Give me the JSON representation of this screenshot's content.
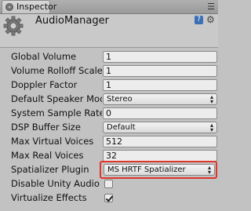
{
  "tab": {
    "label": "Inspector"
  },
  "header": {
    "title": "AudioManager"
  },
  "rows": [
    {
      "label": "Global Volume",
      "value": "1"
    },
    {
      "label": "Volume Rolloff Scale",
      "value": "1"
    },
    {
      "label": "Doppler Factor",
      "value": "1"
    },
    {
      "label": "Default Speaker Mode",
      "value": "Stereo"
    },
    {
      "label": "System Sample Rate",
      "value": "0"
    },
    {
      "label": "DSP Buffer Size",
      "value": "Default"
    },
    {
      "label": "Max Virtual Voices",
      "value": "512"
    },
    {
      "label": "Max Real Voices",
      "value": "32"
    },
    {
      "label": "Spatializer Plugin",
      "value": "MS HRTF Spatializer"
    },
    {
      "label": "Disable Unity Audio",
      "checked": false
    },
    {
      "label": "Virtualize Effects",
      "checked": true
    }
  ],
  "colors": {
    "highlight": "#e0352d",
    "panel": "#c2c2c2"
  }
}
